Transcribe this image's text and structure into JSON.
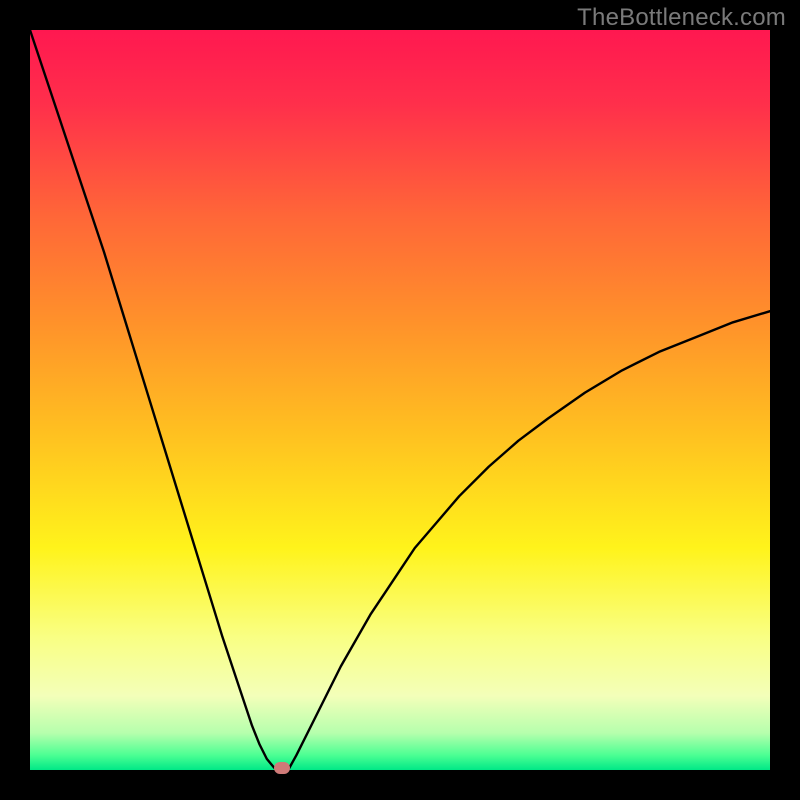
{
  "watermark": "TheBottleneck.com",
  "chart_data": {
    "type": "line",
    "title": "",
    "xlabel": "",
    "ylabel": "",
    "xlim": [
      0,
      100
    ],
    "ylim": [
      0,
      100
    ],
    "grid": false,
    "legend": false,
    "x": [
      0,
      2,
      4,
      6,
      8,
      10,
      12,
      14,
      16,
      18,
      20,
      22,
      24,
      26,
      28,
      30,
      31,
      32,
      33,
      34,
      35,
      36,
      38,
      40,
      42,
      44,
      46,
      48,
      50,
      52,
      55,
      58,
      62,
      66,
      70,
      75,
      80,
      85,
      90,
      95,
      100
    ],
    "y": [
      100,
      94,
      88,
      82,
      76,
      70,
      63.5,
      57,
      50.5,
      44,
      37.5,
      31,
      24.5,
      18,
      12,
      6,
      3.5,
      1.5,
      0.3,
      0,
      0.2,
      2,
      6,
      10,
      14,
      17.5,
      21,
      24,
      27,
      30,
      33.5,
      37,
      41,
      44.5,
      47.5,
      51,
      54,
      56.5,
      58.5,
      60.5,
      62
    ],
    "marker_point": {
      "x": 34,
      "y": 0
    },
    "gradient_stops": [
      {
        "offset": 0.0,
        "color": "#ff1850"
      },
      {
        "offset": 0.1,
        "color": "#ff2f4b"
      },
      {
        "offset": 0.25,
        "color": "#ff6638"
      },
      {
        "offset": 0.4,
        "color": "#ff932a"
      },
      {
        "offset": 0.55,
        "color": "#ffc220"
      },
      {
        "offset": 0.7,
        "color": "#fff31b"
      },
      {
        "offset": 0.82,
        "color": "#f9ff83"
      },
      {
        "offset": 0.9,
        "color": "#f3ffb9"
      },
      {
        "offset": 0.95,
        "color": "#b6ffad"
      },
      {
        "offset": 0.98,
        "color": "#4cff93"
      },
      {
        "offset": 1.0,
        "color": "#00e887"
      }
    ]
  }
}
